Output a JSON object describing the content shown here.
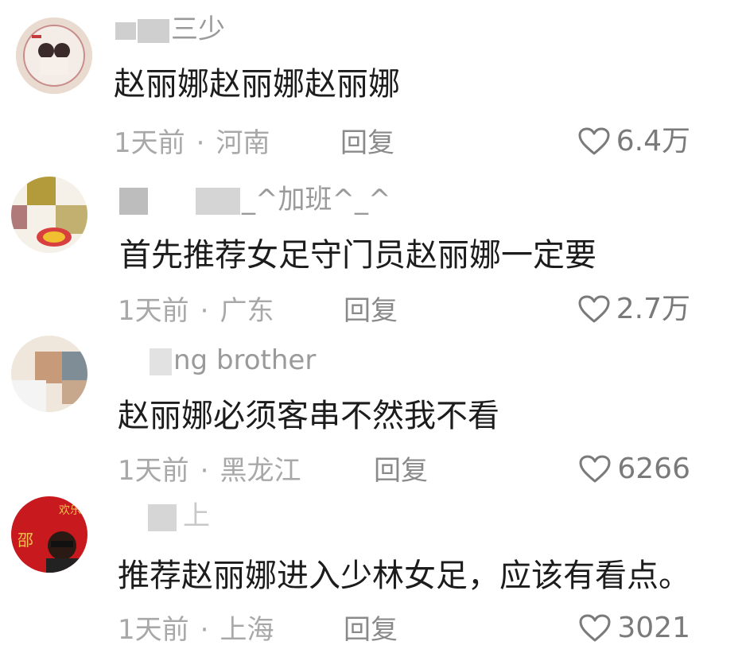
{
  "comments": [
    {
      "username": "三少",
      "text": "赵丽娜赵丽娜赵丽娜",
      "time": "1天前",
      "location": "河南",
      "reply_label": "回复",
      "likes": "6.4万",
      "avatar_colors": [
        "#e8d8cc",
        "#c98c8c"
      ]
    },
    {
      "username": "_^加班^_^",
      "text": "首先推荐女足守门员赵丽娜一定要",
      "time": "1天前",
      "location": "广东",
      "reply_label": "回复",
      "likes": "2.7万",
      "avatar_colors": [
        "#b39a3a",
        "#d84040"
      ]
    },
    {
      "username": "ng brother",
      "text": "赵丽娜必须客串不然我不看",
      "time": "1天前",
      "location": "黑龙江",
      "reply_label": "回复",
      "likes": "6266",
      "avatar_colors": [
        "#c79b7a",
        "#7f8d96"
      ]
    },
    {
      "username": "上",
      "text": "推荐赵丽娜进入少林女足，应该有看点。",
      "time": "1天前",
      "location": "上海",
      "reply_label": "回复",
      "likes": "3021",
      "avatar_colors": [
        "#c8191e",
        "#f2c14e"
      ]
    }
  ],
  "separator": "·",
  "icons": {
    "like": "heart-icon"
  }
}
